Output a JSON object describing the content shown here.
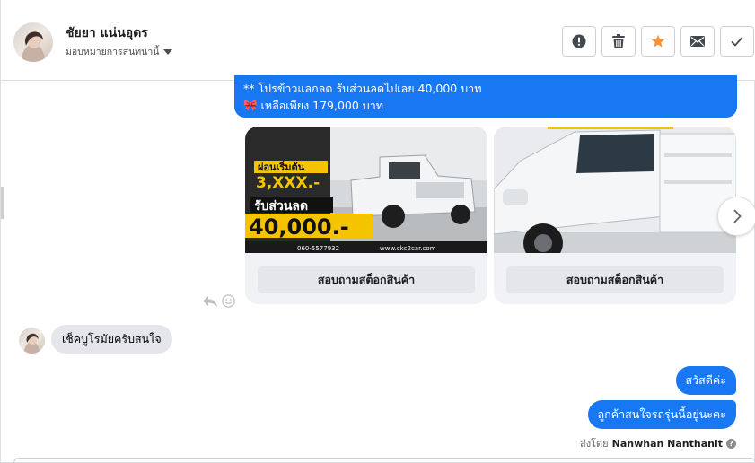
{
  "header": {
    "contact_name": "ชัยยา แน่นอุดร",
    "assign_label": "มอบหมายการสนทนานี้",
    "actions": [
      {
        "name": "report-spam-button",
        "icon": "exclamation-icon"
      },
      {
        "name": "delete-button",
        "icon": "trash-icon"
      },
      {
        "name": "star-button",
        "icon": "star-icon"
      },
      {
        "name": "mark-unread-button",
        "icon": "envelope-icon"
      },
      {
        "name": "mark-done-button",
        "icon": "checkmark-icon"
      }
    ]
  },
  "promo": {
    "line1": "** โปรข้าวแลกลด รับส่วนลดไปเลย 40,000 บาท",
    "line2_icon": "🎀",
    "line2": " เหลือเพียง 179,000 บาท"
  },
  "cards": [
    {
      "button_label": "สอบถามสต็อกสินค้า",
      "image": {
        "top_caption": "ผ่อนเริ่มต้น",
        "installment": "3,XXX.-",
        "discount_caption": "รับส่วนลด",
        "discount_amount": "40,000.-",
        "phone": "060-5577932",
        "website": "www.ckc2car.com"
      }
    },
    {
      "button_label": "สอบถามสต็อกสินค้า"
    }
  ],
  "incoming_message": "เช็คบูโรมัยครับสนใจ",
  "outgoing_messages": [
    "สวัสดีค่ะ",
    "ลูกค้าสนใจรถรุ่นนี้อยู่นะคะ"
  ],
  "sent_by": {
    "prefix": "ส่งโดย",
    "agent_name": "Nanwhan Nanthanit"
  },
  "colors": {
    "accent": "#1877f2",
    "star": "#f7923b",
    "bubble_gray": "#e4e6eb",
    "banner_yellow": "#f5c400"
  }
}
